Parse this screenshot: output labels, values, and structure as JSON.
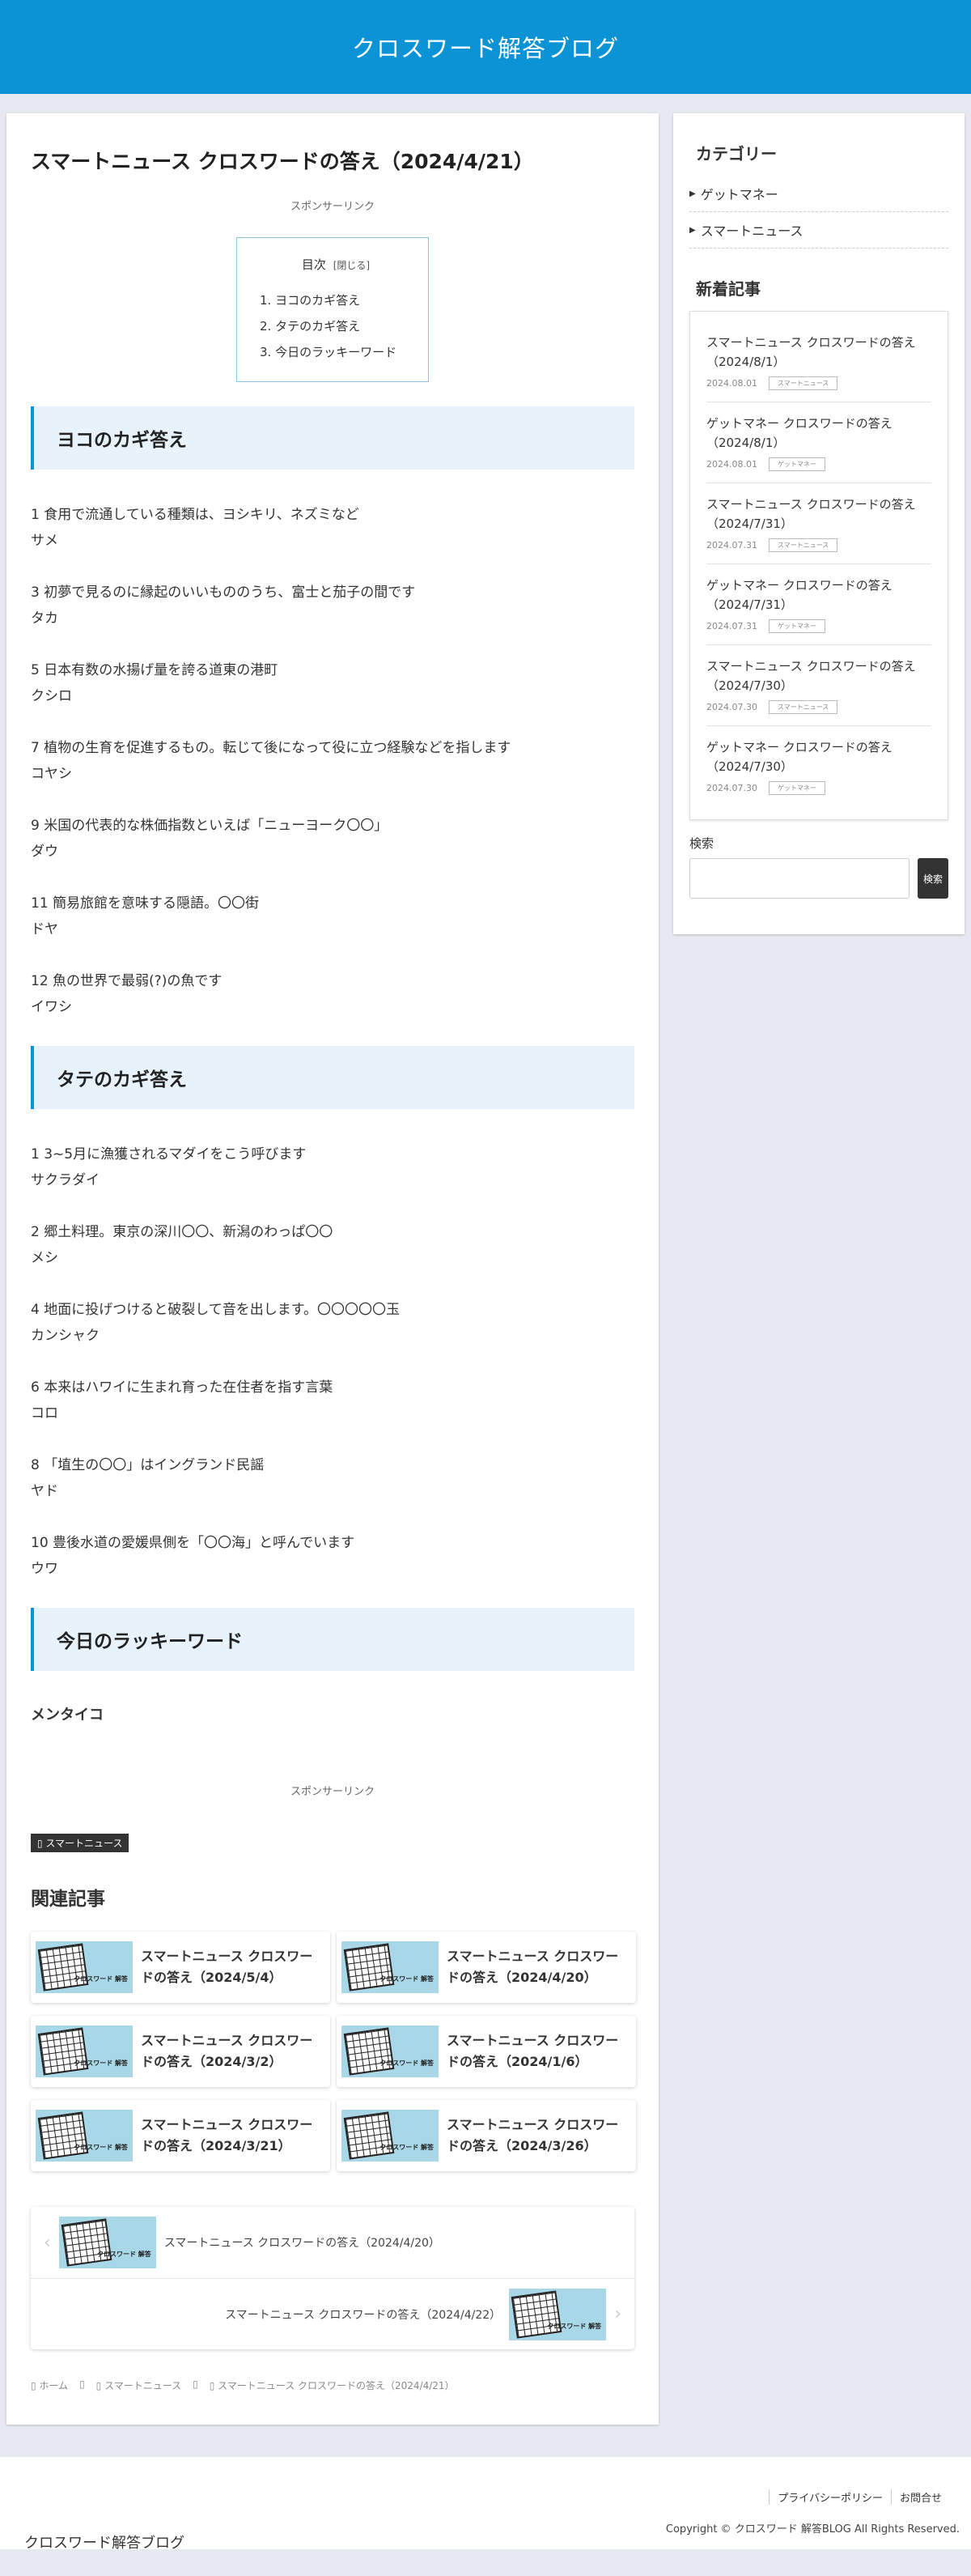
{
  "site": {
    "title": "クロスワード解答ブログ"
  },
  "post": {
    "title": "スマートニュース クロスワードの答え（2024/4/21）",
    "ad_label": "スポンサーリンク",
    "toc": {
      "head": "目次",
      "toggle": "[閉じる]",
      "items": [
        "1. ヨコのカギ答え",
        "2. タテのカギ答え",
        "3. 今日のラッキーワード"
      ]
    },
    "yoko": {
      "heading": "ヨコのカギ答え",
      "items": [
        {
          "q": "1 食用で流通している種類は、ヨシキリ、ネズミなど",
          "a": "サメ"
        },
        {
          "q": "3 初夢で見るのに縁起のいいもののうち、富士と茄子の間です",
          "a": "タカ"
        },
        {
          "q": "5 日本有数の水揚げ量を誇る道東の港町",
          "a": "クシロ"
        },
        {
          "q": "7 植物の生育を促進するもの。転じて後になって役に立つ経験などを指します",
          "a": "コヤシ"
        },
        {
          "q": "9 米国の代表的な株価指数といえば「ニューヨーク〇〇」",
          "a": "ダウ"
        },
        {
          "q": "11 簡易旅館を意味する隠語。〇〇街",
          "a": "ドヤ"
        },
        {
          "q": "12 魚の世界で最弱(?)の魚です",
          "a": "イワシ"
        }
      ]
    },
    "tate": {
      "heading": "タテのカギ答え",
      "items": [
        {
          "q": "1 3~5月に漁獲されるマダイをこう呼びます",
          "a": "サクラダイ"
        },
        {
          "q": "2 郷土料理。東京の深川〇〇、新潟のわっぱ〇〇",
          "a": "メシ"
        },
        {
          "q": "4 地面に投げつけると破裂して音を出します。〇〇〇〇〇玉",
          "a": "カンシャク"
        },
        {
          "q": "6 本来はハワイに生まれ育った在住者を指す言葉",
          "a": "コロ"
        },
        {
          "q": "8 「埴生の〇〇」はイングランド民謡",
          "a": "ヤド"
        },
        {
          "q": "10 豊後水道の愛媛県側を「〇〇海」と呼んでいます",
          "a": "ウワ"
        }
      ]
    },
    "lucky": {
      "heading": "今日のラッキーワード",
      "word": "メンタイコ"
    },
    "category_tag": "▯ スマートニュース",
    "related": {
      "heading": "関連記事",
      "thumb_label": "クロスワード 解答",
      "items": [
        "スマートニュース クロスワードの答え（2024/5/4）",
        "スマートニュース クロスワードの答え（2024/4/20）",
        "スマートニュース クロスワードの答え（2024/3/2）",
        "スマートニュース クロスワードの答え（2024/1/6）",
        "スマートニュース クロスワードの答え（2024/3/21）",
        "スマートニュース クロスワードの答え（2024/3/26）"
      ]
    },
    "nav": {
      "prev": "スマートニュース クロスワードの答え（2024/4/20）",
      "next": "スマートニュース クロスワードの答え（2024/4/22）"
    },
    "breadcrumb": [
      "▯ ホーム",
      "▯",
      "▯ スマートニュース",
      "▯",
      "▯ スマートニュース クロスワードの答え（2024/4/21）"
    ]
  },
  "sidebar": {
    "categories": {
      "heading": "カテゴリー",
      "items": [
        "ゲットマネー",
        "スマートニュース"
      ]
    },
    "recent": {
      "heading": "新着記事",
      "items": [
        {
          "title": "スマートニュース クロスワードの答え（2024/8/1）",
          "date": "2024.08.01",
          "cat": "スマートニュース"
        },
        {
          "title": "ゲットマネー クロスワードの答え（2024/8/1）",
          "date": "2024.08.01",
          "cat": "ゲットマネー"
        },
        {
          "title": "スマートニュース クロスワードの答え（2024/7/31）",
          "date": "2024.07.31",
          "cat": "スマートニュース"
        },
        {
          "title": "ゲットマネー クロスワードの答え（2024/7/31）",
          "date": "2024.07.31",
          "cat": "ゲットマネー"
        },
        {
          "title": "スマートニュース クロスワードの答え（2024/7/30）",
          "date": "2024.07.30",
          "cat": "スマートニュース"
        },
        {
          "title": "ゲットマネー クロスワードの答え（2024/7/30）",
          "date": "2024.07.30",
          "cat": "ゲットマネー"
        }
      ]
    },
    "search": {
      "label": "検索",
      "button": "検索"
    }
  },
  "footer": {
    "links": [
      "プライバシーポリシー",
      "お問合せ"
    ],
    "copyright": "Copyright © クロスワード 解答BLOG All Rights Reserved.",
    "site_title": "クロスワード解答ブログ"
  },
  "colors": {
    "accent": "#0b93d6",
    "heading_bg": "#e7f2fb",
    "page_bg": "#e6eaf0"
  }
}
